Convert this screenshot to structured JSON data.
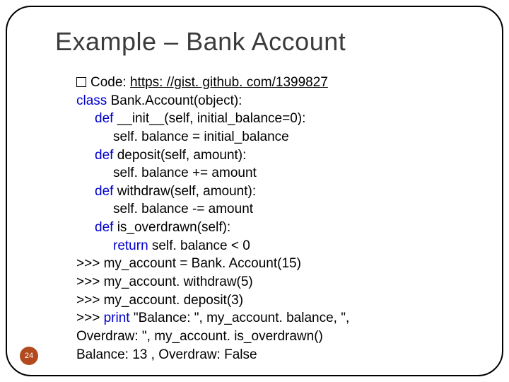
{
  "title": "Example – Bank Account",
  "bullet": {
    "prefix": "Code: ",
    "link_text": "https: //gist. github. com/1399827"
  },
  "code": {
    "l01a": "class",
    "l01b": " Bank.Account(object):",
    "l02a": "def",
    "l02b": " __init__(self, initial_balance=0):",
    "l03": "self. balance = initial_balance",
    "l04a": "def",
    "l04b": " deposit(self, amount):",
    "l05": "self. balance += amount",
    "l06a": "def",
    "l06b": " withdraw(self, amount):",
    "l07": "self. balance -= amount",
    "l08a": "def",
    "l08b": " is_overdrawn(self):",
    "l09a": "return",
    "l09b": " self. balance < 0",
    "l10": ">>> my_account = Bank. Account(15)",
    "l11": ">>> my_account. withdraw(5)",
    "l12": ">>> my_account. deposit(3)",
    "l13a": ">>> ",
    "l13b": "print",
    "l13c": " \"Balance: \", my_account. balance, \",",
    "l14": "Overdraw: \", my_account. is_overdrawn()",
    "l15": "Balance: 13 , Overdraw: False"
  },
  "page_number": "24"
}
